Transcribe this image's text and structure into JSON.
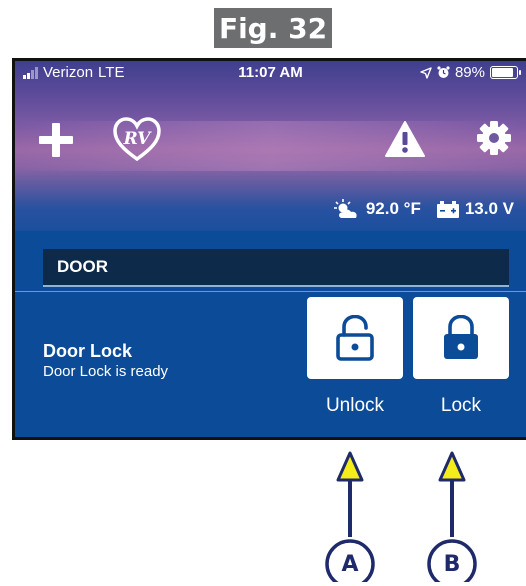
{
  "figure": {
    "label": "Fig. 32"
  },
  "status_bar": {
    "carrier": "Verizon",
    "network": "LTE",
    "time": "11:07 AM",
    "battery_percent": "89%",
    "battery_level": 0.89
  },
  "toolbar": {
    "icons": [
      "plus-icon",
      "rv-heart-logo-icon",
      "warning-icon",
      "gear-icon"
    ]
  },
  "readouts": {
    "temperature": "92.0 °F",
    "voltage": "13.0 V"
  },
  "section": {
    "title": "DOOR"
  },
  "device": {
    "name": "Door Lock",
    "status": "Door Lock is ready",
    "unlock_label": "Unlock",
    "lock_label": "Lock"
  },
  "callouts": {
    "a": "A",
    "b": "B"
  },
  "colors": {
    "panel_blue": "#0b4b98",
    "section_header": "#0d2a4a",
    "callout_yellow": "#f5ec1c",
    "callout_navy": "#1f2a6b",
    "fig_label_gray": "#6d6e70"
  }
}
